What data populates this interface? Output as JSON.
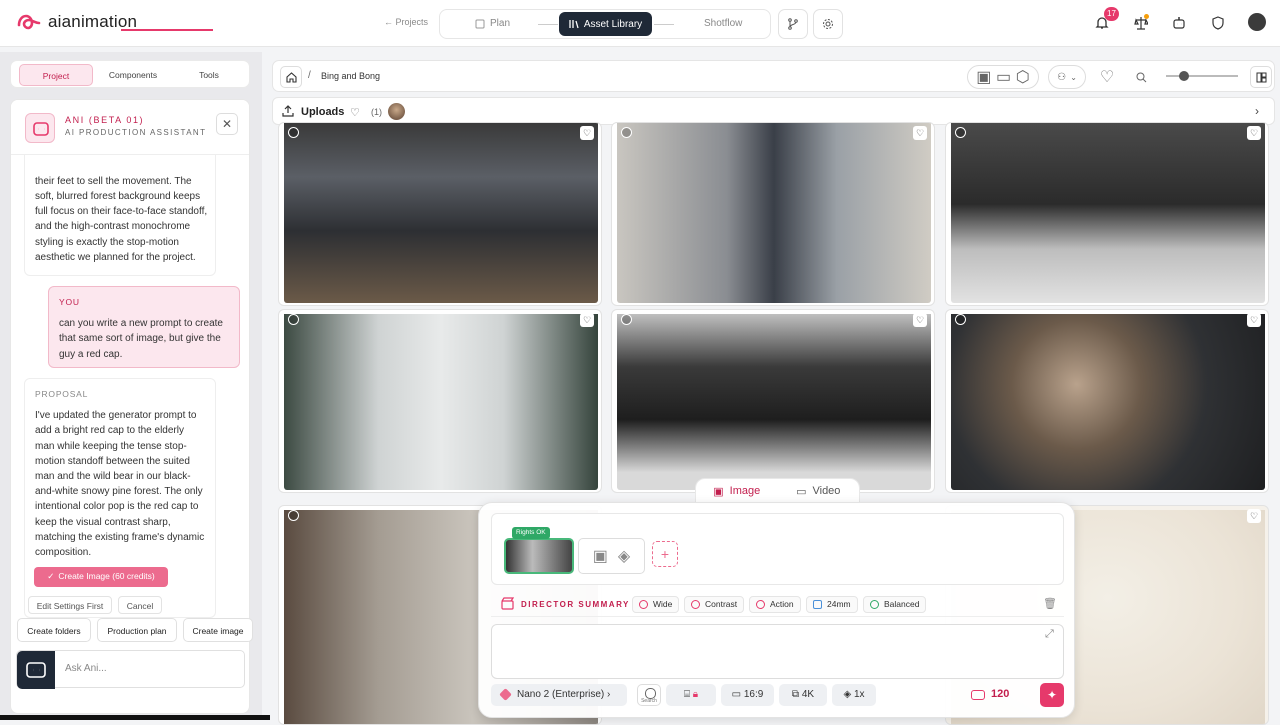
{
  "app": {
    "name": "aianimation"
  },
  "nav": {
    "back": "← Projects",
    "plan": "Plan",
    "active": "Asset Library",
    "shotflow": "Shotflow"
  },
  "header": {
    "notifications": "17"
  },
  "left_tabs": [
    "Project",
    "Components",
    "Tools"
  ],
  "assistant": {
    "title": "ANI (BETA 01)",
    "subtitle": "AI PRODUCTION ASSISTANT",
    "msg1": "their feet to sell the movement. The soft, blurred forest background keeps full focus on their face-to-face standoff, and the high-contrast monochrome styling is exactly the stop-motion aesthetic we planned for the project.",
    "you_label": "YOU",
    "msg2": "can you write a new prompt to create that same sort of image, but give the guy a red cap.",
    "proposal_label": "PROPOSAL",
    "msg3": "I've updated the generator prompt to add a bright red cap to the elderly man while keeping the tense stop-motion standoff between the suited man and the wild bear in our black-and-white snowy pine forest. The only intentional color pop is the red cap to keep the visual contrast sharp, matching the existing frame's dynamic composition.",
    "create_btn": "Create Image (60 credits)",
    "edit_btn": "Edit Settings First",
    "cancel_btn": "Cancel"
  },
  "quick_actions": [
    "Create folders",
    "Production plan",
    "Create image"
  ],
  "ask_placeholder": "Ask Ani...",
  "breadcrumb": {
    "sep": "/",
    "project": "Bing and Bong"
  },
  "uploads": {
    "label": "Uploads",
    "count": "(1)"
  },
  "composer": {
    "mode_image": "Image",
    "mode_video": "Video",
    "rights": "Rights OK",
    "director_label": "DIRECTOR SUMMARY",
    "chips": [
      "Wide",
      "Contrast",
      "Action",
      "24mm",
      "Balanced"
    ],
    "model": "Nano 2 (Enterprise)  ›",
    "search": "Search",
    "aspect": "16:9",
    "resolution": "4K",
    "count": "1x",
    "credits": "120"
  },
  "colors": {
    "accent": "#e6396b",
    "dark": "#1f2937",
    "ok": "#2fa866"
  }
}
